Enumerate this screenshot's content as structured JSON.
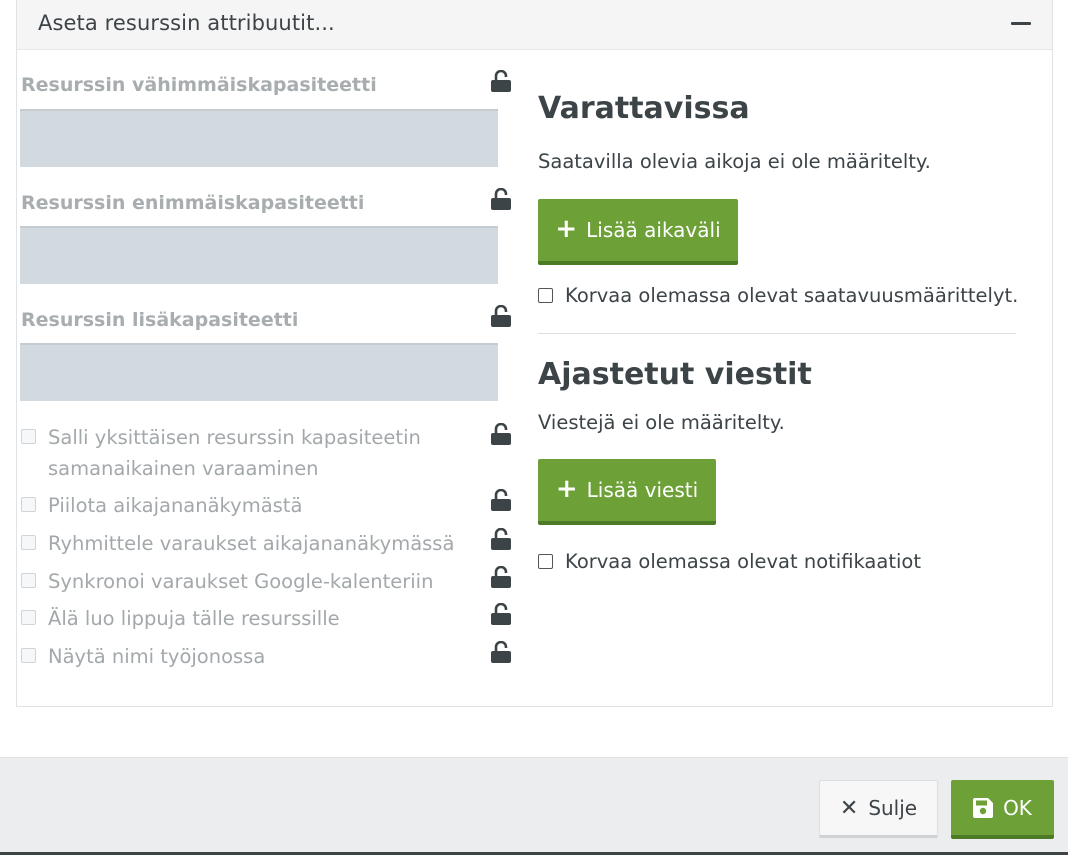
{
  "panel": {
    "title": "Aseta resurssin attribuutit...",
    "collapse_icon": "minus-icon"
  },
  "left": {
    "fields": [
      {
        "label": "Resurssin vähimmäiskapasiteetti",
        "value": ""
      },
      {
        "label": "Resurssin enimmäiskapasiteetti",
        "value": ""
      },
      {
        "label": "Resurssin lisäkapasiteetti",
        "value": ""
      }
    ],
    "checkboxes": [
      {
        "label_line1": "Salli yksittäisen resurssin kapasiteetin",
        "label_line2": "samanaikainen varaaminen",
        "checked": false
      },
      {
        "label": "Piilota aikajananäkymästä",
        "checked": false
      },
      {
        "label": "Ryhmittele varaukset aikajananäkymässä",
        "checked": false
      },
      {
        "label": "Synkronoi varaukset Google-kalenteriin",
        "checked": false
      },
      {
        "label": "Älä luo lippuja tälle resurssille",
        "checked": false
      },
      {
        "label": "Näytä nimi työjonossa",
        "checked": false
      }
    ],
    "lock_icon": "unlock-icon"
  },
  "availability": {
    "title": "Varattavissa",
    "empty_text": "Saatavilla olevia aikoja ei ole määritelty.",
    "add_button": "Lisää aikaväli",
    "replace_checkbox": "Korvaa olemassa olevat saatavuusmäärittelyt."
  },
  "messages": {
    "title": "Ajastetut viestit",
    "empty_text": "Viestejä ei ole määritelty.",
    "add_button": "Lisää viesti",
    "replace_checkbox": "Korvaa olemassa olevat notifikaatiot"
  },
  "footer": {
    "close_label": "Sulje",
    "ok_label": "OK"
  },
  "colors": {
    "accent_green": "#6da138",
    "input_bg": "#d2d9df",
    "text_dark": "#3c4448",
    "text_muted": "#a8adb0"
  }
}
